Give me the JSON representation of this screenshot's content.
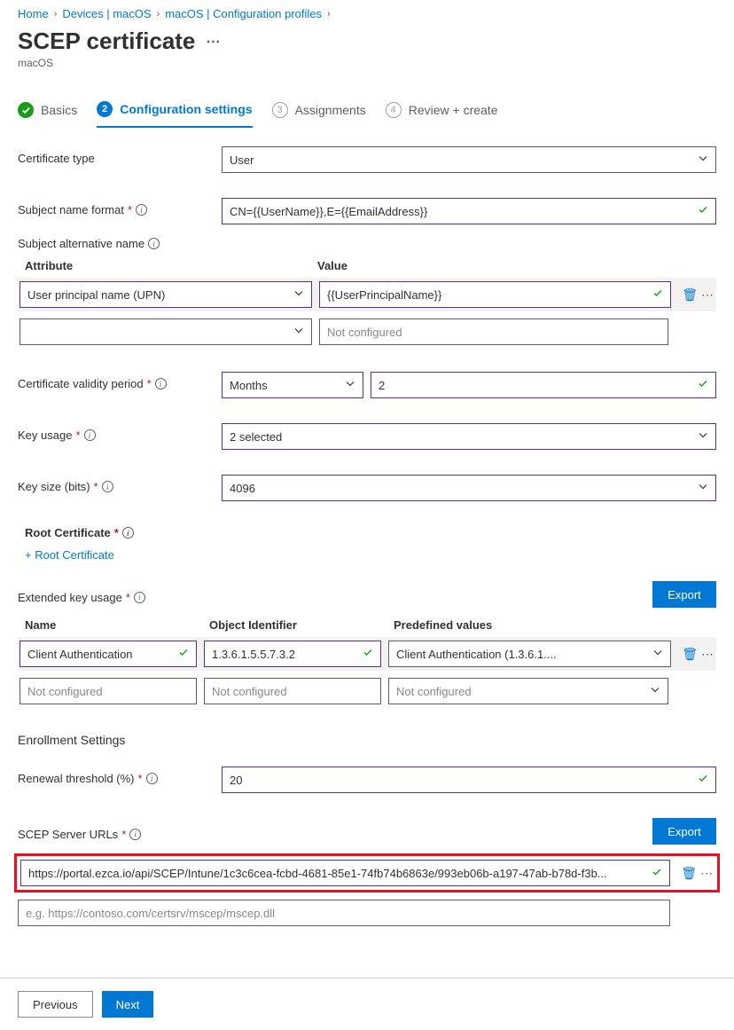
{
  "breadcrumb": {
    "home": "Home",
    "devices": "Devices | macOS",
    "config": "macOS | Configuration profiles"
  },
  "page": {
    "title": "SCEP certificate",
    "subtitle": "macOS"
  },
  "tabs": {
    "basics": "Basics",
    "config_num": "2",
    "config": "Configuration settings",
    "assign_num": "3",
    "assign": "Assignments",
    "review_num": "4",
    "review": "Review + create"
  },
  "labels": {
    "cert_type": "Certificate type",
    "subj_name": "Subject name format",
    "san": "Subject alternative name",
    "attribute": "Attribute",
    "value": "Value",
    "validity": "Certificate validity period",
    "key_usage": "Key usage",
    "key_size": "Key size (bits)",
    "root": "Root Certificate",
    "root_link": "+ Root Certificate",
    "eku": "Extended key usage",
    "name": "Name",
    "oid": "Object Identifier",
    "predef": "Predefined values",
    "enroll": "Enrollment Settings",
    "renewal": "Renewal threshold (%)",
    "urls": "SCEP Server URLs",
    "export": "Export",
    "prev": "Previous",
    "next": "Next"
  },
  "values": {
    "cert_type": "User",
    "subj_name": "CN={{UserName}},E={{EmailAddress}}",
    "san_attr": "User principal name (UPN)",
    "san_val": "{{UserPrincipalName}}",
    "san_placeholder": "Not configured",
    "validity_unit": "Months",
    "validity_val": "2",
    "key_usage": "2 selected",
    "key_size": "4096",
    "eku_name": "Client Authentication",
    "eku_oid": "1.3.6.1.5.5.7.3.2",
    "eku_predef": "Client Authentication (1.3.6.1....",
    "not_conf": "Not configured",
    "renewal": "20",
    "url1": "https://portal.ezca.io/api/SCEP/Intune/1c3c6cea-fcbd-4681-85e1-74fb74b6863e/993eb06b-a197-47ab-b78d-f3b...",
    "url_placeholder": "e.g. https://contoso.com/certsrv/mscep/mscep.dll"
  }
}
